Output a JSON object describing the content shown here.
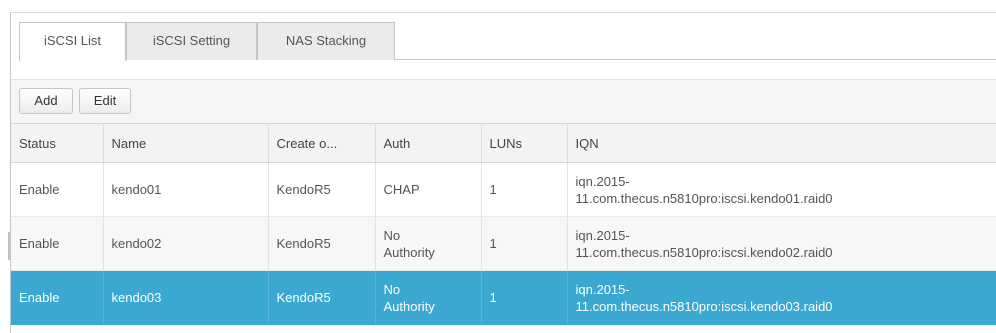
{
  "tabs": [
    {
      "label": "iSCSI List",
      "active": true
    },
    {
      "label": "iSCSI Setting",
      "active": false
    },
    {
      "label": "NAS Stacking",
      "active": false
    }
  ],
  "toolbar": {
    "add_label": "Add",
    "edit_label": "Edit"
  },
  "table": {
    "columns": [
      "Status",
      "Name",
      "Create o...",
      "Auth",
      "LUNs",
      "IQN"
    ],
    "rows": [
      {
        "status": "Enable",
        "name": "kendo01",
        "created_on": "KendoR5",
        "auth": "CHAP",
        "luns": "1",
        "iqn": "iqn.2015-\n11.com.thecus.n5810pro:iscsi.kendo01.raid0",
        "selected": false
      },
      {
        "status": "Enable",
        "name": "kendo02",
        "created_on": "KendoR5",
        "auth": "No\nAuthority",
        "luns": "1",
        "iqn": "iqn.2015-\n11.com.thecus.n5810pro:iscsi.kendo02.raid0",
        "selected": false
      },
      {
        "status": "Enable",
        "name": "kendo03",
        "created_on": "KendoR5",
        "auth": "No\nAuthority",
        "luns": "1",
        "iqn": "iqn.2015-\n11.com.thecus.n5810pro:iscsi.kendo03.raid0",
        "selected": true
      }
    ]
  },
  "colors": {
    "selected_row": "#3aa8d0",
    "header_bg": "#f3f3f3",
    "toolbar_bg": "#f5f5f5"
  }
}
